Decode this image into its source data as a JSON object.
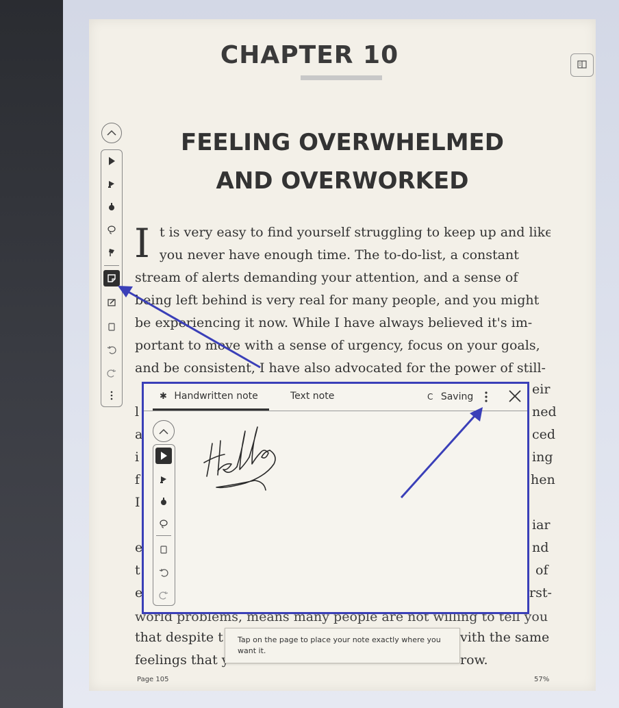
{
  "book": {
    "chapter_title": "CHAPTER 10",
    "title_line_1": "FEELING OVERWHELMED",
    "title_line_2": "AND OVERWORKED",
    "dropcap": "I",
    "lines": [
      "t is very easy to find yourself struggling to keep up and like",
      "you never have enough time. The to-do-list, a constant",
      "stream of alerts demanding your attention, and a sense of",
      "being left behind is very real for many people, and you might",
      "be experiencing it now. While I have always believed it's im-",
      "portant to move with a sense of urgency, focus on your goals,",
      "and be consistent, I have also advocated for the power of still-"
    ],
    "right_fragments": [
      "eir",
      "ned",
      "ced",
      "ing",
      "hen",
      "iar",
      "nd",
      "of",
      "rst-"
    ],
    "left_fragments": [
      "l",
      "a",
      "i",
      "f",
      "I",
      "e",
      "t",
      "e"
    ],
    "lower_lines": [
      "world problems, means many people are not willing to tell you",
      "that despite t",
      "vith the same",
      "feelings that y",
      "row."
    ],
    "page_label": "Page 105",
    "progress_label": "57%"
  },
  "toolbar": {
    "icons": [
      "pen-icon",
      "highlighter-icon",
      "fountain-pen-icon",
      "lasso-icon",
      "marker-icon",
      "sticky-note-icon",
      "edit-box-icon",
      "eraser-icon",
      "undo-icon",
      "redo-icon",
      "more-icon"
    ]
  },
  "note_panel": {
    "tab_handwritten": "Handwritten note",
    "tab_text": "Text note",
    "saving_label": "Saving",
    "handwritten_content": "Hello"
  },
  "tooltip": {
    "text": "Tap on the page to place your note exactly where you want it."
  },
  "colors": {
    "annotation_blue": "#3a3fb8",
    "page_background": "#f3f0e8"
  }
}
